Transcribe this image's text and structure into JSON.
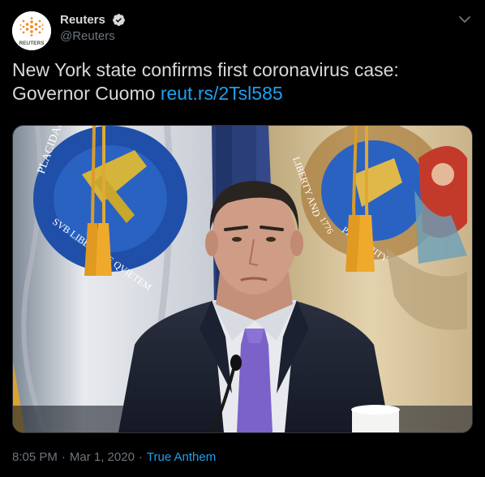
{
  "author": {
    "display_name": "Reuters",
    "handle": "@Reuters",
    "avatar_logo_text": "REUTERS",
    "verified": true
  },
  "tweet": {
    "text": "New York state confirms first coronavirus case: Governor Cuomo ",
    "link": "reut.rs/2Tsl585"
  },
  "media": {
    "description": "photo",
    "seal_texts": [
      "PLACIDAM",
      "SVB LIBERTATE QVIETEM",
      "LIBERTY AND",
      "1776",
      "PROSPERITY"
    ]
  },
  "meta": {
    "time": "8:05 PM",
    "separator": "·",
    "date": "Mar 1, 2020",
    "source": "True Anthem"
  },
  "colors": {
    "background": "#000000",
    "text": "#d9d9d9",
    "secondary": "#6e767d",
    "link": "#1da1f2",
    "brand_orange": "#f08a24"
  },
  "icons": {
    "verified": "verified-badge-icon",
    "caret": "chevron-down-icon"
  }
}
